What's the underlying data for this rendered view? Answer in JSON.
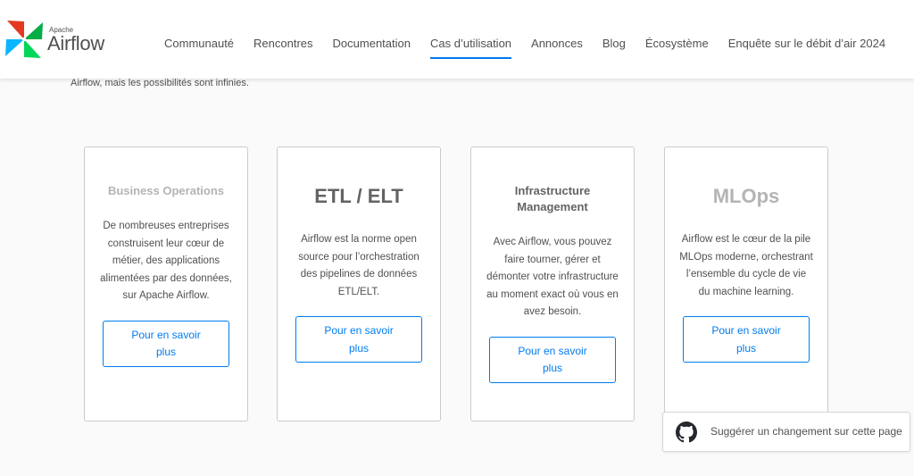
{
  "header": {
    "brand_small": "Apache",
    "brand": "Airflow",
    "nav": [
      {
        "label": "Communauté",
        "active": false
      },
      {
        "label": "Rencontres",
        "active": false
      },
      {
        "label": "Documentation",
        "active": false
      },
      {
        "label": "Cas d’utilisation",
        "active": true
      },
      {
        "label": "Annonces",
        "active": false
      },
      {
        "label": "Blog",
        "active": false
      },
      {
        "label": "Écosystème",
        "active": false
      },
      {
        "label": "Enquête sur le débit d’air 2024",
        "active": false
      }
    ]
  },
  "intro_text": "Airflow, mais les possibilités sont infinies.",
  "cards": [
    {
      "title": "Business Operations",
      "description": "De nombreuses entreprises construisent leur cœur de métier, des applications alimentées par des données, sur Apache Airflow.",
      "button": "Pour en savoir plus"
    },
    {
      "title": "ETL / ELT",
      "description": "Airflow est la norme open source pour l’orchestration des pipelines de données ETL/ELT.",
      "button": "Pour en savoir plus"
    },
    {
      "title": "Infrastructure Management",
      "description": "Avec Airflow, vous pouvez faire tourner, gérer et démonter votre infrastructure au moment exact où vous en avez besoin.",
      "button": "Pour en savoir plus"
    },
    {
      "title": "MLOps",
      "description": "Airflow est le cœur de la pile MLOps moderne, orchestrant l’ensemble du cycle de vie du machine learning.",
      "button": "Pour en savoir plus"
    }
  ],
  "suggest": {
    "label": "Suggérer un changement sur cette page",
    "icon": "github-icon"
  },
  "colors": {
    "accent": "#017cee",
    "text": "#51504f",
    "card_border": "#cbcbcb",
    "logo_red": "#e43921",
    "logo_teal": "#00ad46",
    "logo_blue": "#0cb6ff",
    "logo_green": "#04d659"
  }
}
